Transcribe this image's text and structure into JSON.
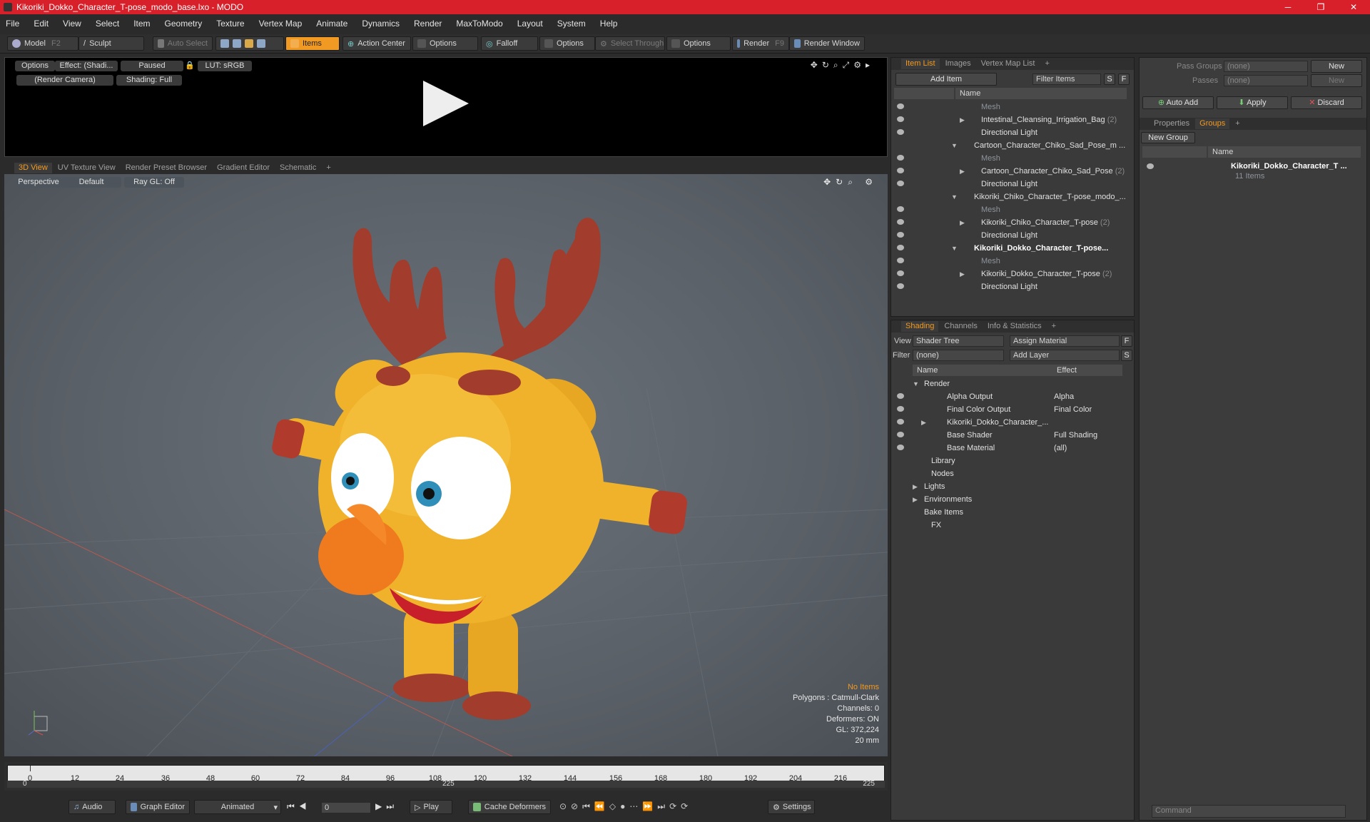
{
  "window": {
    "title": "Kikoriki_Dokko_Character_T-pose_modo_base.lxo - MODO"
  },
  "menu": [
    "File",
    "Edit",
    "View",
    "Select",
    "Item",
    "Geometry",
    "Texture",
    "Vertex Map",
    "Animate",
    "Dynamics",
    "Render",
    "MaxToModo",
    "Layout",
    "System",
    "Help"
  ],
  "toolbar": {
    "model": "Model",
    "model_key": "F2",
    "sculpt": "Sculpt",
    "auto_select": "Auto Select",
    "items": "Items",
    "action_center": "Action Center",
    "options1": "Options",
    "falloff": "Falloff",
    "options2": "Options",
    "select_through": "Select Through",
    "options3": "Options",
    "render": "Render",
    "render_key": "F9",
    "render_window": "Render Window"
  },
  "preview": {
    "options": "Options",
    "effect": "Effect: (Shadi...",
    "paused": "Paused",
    "lut": "LUT: sRGB",
    "camera": "(Render Camera)",
    "shading": "Shading: Full"
  },
  "viewport_tabs": [
    "3D View",
    "UV Texture View",
    "Render Preset Browser",
    "Gradient Editor",
    "Schematic",
    "+"
  ],
  "viewport": {
    "perspective": "Perspective",
    "default": "Default",
    "raygl": "Ray GL: Off",
    "info": {
      "items": "No Items",
      "polygons": "Polygons : Catmull-Clark",
      "channels": "Channels: 0",
      "deformers": "Deformers: ON",
      "gl": "GL: 372,224",
      "scale": "20 mm"
    }
  },
  "timeline": {
    "ticks": [
      "0",
      "12",
      "24",
      "36",
      "48",
      "60",
      "72",
      "84",
      "96",
      "108",
      "120",
      "132",
      "144",
      "156",
      "168",
      "180",
      "192",
      "204",
      "216"
    ],
    "start": "0",
    "mid": "225",
    "end": "225"
  },
  "bottombar": {
    "audio": "Audio",
    "graph_editor": "Graph Editor",
    "animated": "Animated",
    "frame": "0",
    "play": "Play",
    "cache": "Cache Deformers",
    "settings": "Settings"
  },
  "itemlist": {
    "tabs": [
      "Item List",
      "Images",
      "Vertex Map List",
      "+"
    ],
    "add_item": "Add Item",
    "filter": "Filter Items",
    "s": "S",
    "f": "F",
    "col_name": "Name",
    "rows": [
      {
        "name": "Mesh",
        "dim": true,
        "indent": 3
      },
      {
        "name": "Intestinal_Cleansing_Irrigation_Bag",
        "count": "(2)",
        "indent": 3,
        "arrow": "▶"
      },
      {
        "name": "Directional Light",
        "indent": 3
      },
      {
        "name": "Cartoon_Character_Chiko_Sad_Pose_m ...",
        "indent": 2,
        "arrow": "▼"
      },
      {
        "name": "Mesh",
        "dim": true,
        "indent": 3
      },
      {
        "name": "Cartoon_Character_Chiko_Sad_Pose",
        "count": "(2)",
        "indent": 3,
        "arrow": "▶"
      },
      {
        "name": "Directional Light",
        "indent": 3
      },
      {
        "name": "Kikoriki_Chiko_Character_T-pose_modo_...",
        "indent": 2,
        "arrow": "▼"
      },
      {
        "name": "Mesh",
        "dim": true,
        "indent": 3
      },
      {
        "name": "Kikoriki_Chiko_Character_T-pose",
        "count": "(2)",
        "indent": 3,
        "arrow": "▶"
      },
      {
        "name": "Directional Light",
        "indent": 3
      },
      {
        "name": "Kikoriki_Dokko_Character_T-pose...",
        "indent": 2,
        "arrow": "▼",
        "bold": true
      },
      {
        "name": "Mesh",
        "dim": true,
        "indent": 3
      },
      {
        "name": "Kikoriki_Dokko_Character_T-pose",
        "count": "(2)",
        "indent": 3,
        "arrow": "▶"
      },
      {
        "name": "Directional Light",
        "indent": 3
      }
    ]
  },
  "shading": {
    "tabs": [
      "Shading",
      "Channels",
      "Info & Statistics",
      "+"
    ],
    "view_label": "View",
    "view_value": "Shader Tree",
    "assign": "Assign Material",
    "f": "F",
    "filter_label": "Filter",
    "filter_value": "(none)",
    "add_layer": "Add Layer",
    "s": "S",
    "col_name": "Name",
    "col_effect": "Effect",
    "rows": [
      {
        "name": "Render",
        "effect": "",
        "indent": 1,
        "arrow": "▼"
      },
      {
        "name": "Alpha Output",
        "effect": "Alpha",
        "indent": 2
      },
      {
        "name": "Final Color Output",
        "effect": "Final Color",
        "indent": 2
      },
      {
        "name": "Kikoriki_Dokko_Character_...",
        "effect": "",
        "indent": 2,
        "arrow": "▶"
      },
      {
        "name": "Base Shader",
        "effect": "Full Shading",
        "indent": 2
      },
      {
        "name": "Base Material",
        "effect": "(all)",
        "indent": 2
      },
      {
        "name": "Library",
        "effect": "",
        "indent": 1
      },
      {
        "name": "Nodes",
        "effect": "",
        "indent": 1
      },
      {
        "name": "Lights",
        "effect": "",
        "indent": 0,
        "arrow": "▶"
      },
      {
        "name": "Environments",
        "effect": "",
        "indent": 0,
        "arrow": "▶"
      },
      {
        "name": "Bake Items",
        "effect": "",
        "indent": 0
      },
      {
        "name": "FX",
        "effect": "",
        "indent": 1
      }
    ]
  },
  "groups": {
    "pass_groups": "Pass Groups",
    "pass_value": "(none)",
    "new": "New",
    "passes": "Passes",
    "passes_value": "(none)",
    "new2": "New",
    "auto_add": "Auto Add",
    "apply": "Apply",
    "discard": "Discard",
    "tabs": [
      "Properties",
      "Groups",
      "+"
    ],
    "new_group": "New Group",
    "col_name": "Name",
    "item_name": "Kikoriki_Dokko_Character_T ...",
    "item_count": "11 Items"
  },
  "command": {
    "placeholder": "Command"
  },
  "colors": {
    "accent": "#f19a23",
    "titlebar": "#d7202a",
    "body": "#f0b22a",
    "antler": "#a23c2c",
    "nose": "#f07a1e"
  }
}
